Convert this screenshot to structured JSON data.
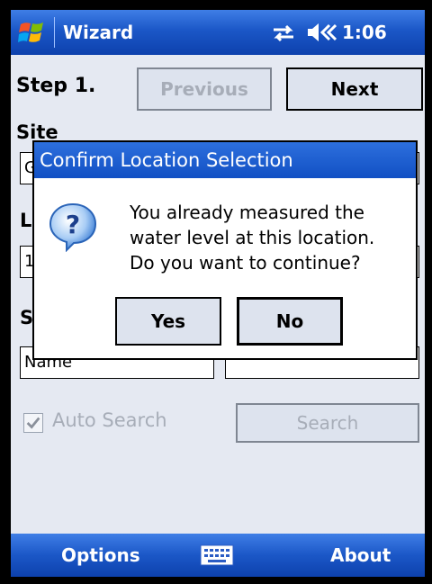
{
  "titlebar": {
    "app_title": "Wizard",
    "time": "1:06",
    "icons": [
      "windows-logo-icon",
      "connectivity-icon",
      "volume-icon"
    ]
  },
  "wizard": {
    "step_label": "Step 1.",
    "previous_label": "Previous",
    "next_label": "Next",
    "site_label": "Site",
    "site_value": "G",
    "location_label": "L",
    "location_value": "1",
    "search_by_label": "S",
    "name_value": "Name",
    "auto_search_label": "Auto Search",
    "auto_search_checked": true,
    "search_button": "Search"
  },
  "dialog": {
    "title": "Confirm Location Selection",
    "message": "You already measured the\nwater level at this location.\nDo you want to continue?",
    "icon": "question-icon",
    "yes_label": "Yes",
    "no_label": "No"
  },
  "bottombar": {
    "left_label": "Options",
    "right_label": "About",
    "center_icon": "keyboard-icon"
  },
  "colors": {
    "titlebar_blue": "#1b57c7",
    "background": "#e5e9f2"
  }
}
